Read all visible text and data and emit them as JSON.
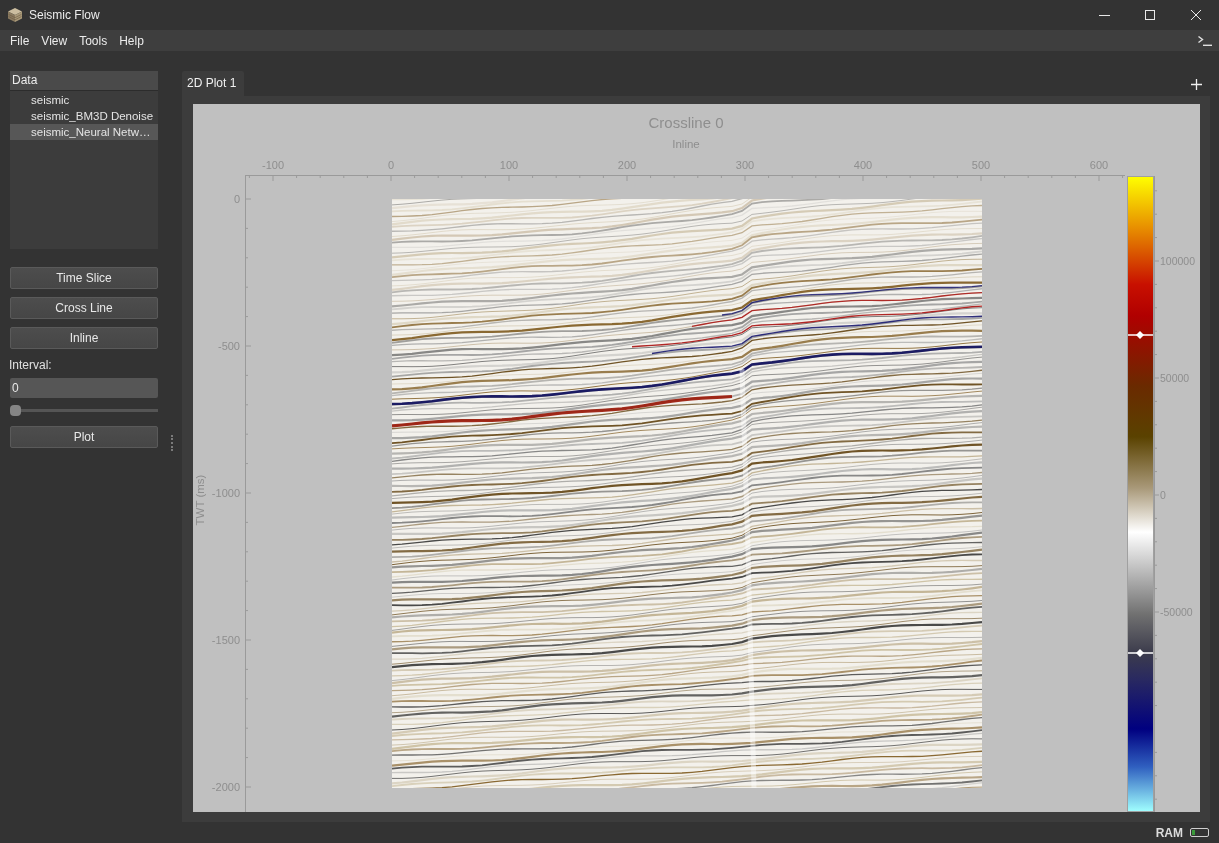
{
  "window": {
    "title": "Seismic Flow"
  },
  "menu": [
    "File",
    "View",
    "Tools",
    "Help"
  ],
  "data_panel": {
    "header": "Data",
    "items": [
      {
        "label": "seismic",
        "selected": false
      },
      {
        "label": "seismic_BM3D Denoise",
        "selected": false
      },
      {
        "label": "seismic_Neural Netw…",
        "selected": true
      }
    ]
  },
  "slice_buttons": [
    "Time Slice",
    "Cross Line",
    "Inline"
  ],
  "interval": {
    "label": "Interval:",
    "value": "0",
    "slider": {
      "level": 0
    }
  },
  "plot_button": "Plot",
  "tabs": [
    {
      "label": "2D Plot 1",
      "selected": true
    }
  ],
  "plot": {
    "title": "Crossline 0",
    "x_axis": {
      "label": "Inline",
      "ticks": [
        "-100",
        "0",
        "100",
        "200",
        "300",
        "400",
        "500",
        "600"
      ]
    },
    "y_axis": {
      "label": "TWT (ms)",
      "ticks": [
        "0",
        "-500",
        "-1000",
        "-1500",
        "-2000"
      ]
    },
    "colorbar": {
      "ticks": [
        "100000",
        "50000",
        "0",
        "-50000"
      ],
      "handles": [
        {
          "level": 0.75
        },
        {
          "level": 0.25
        }
      ]
    }
  },
  "status_bar": {
    "label": "RAM",
    "ram_meter": {
      "level": 0.2
    }
  }
}
